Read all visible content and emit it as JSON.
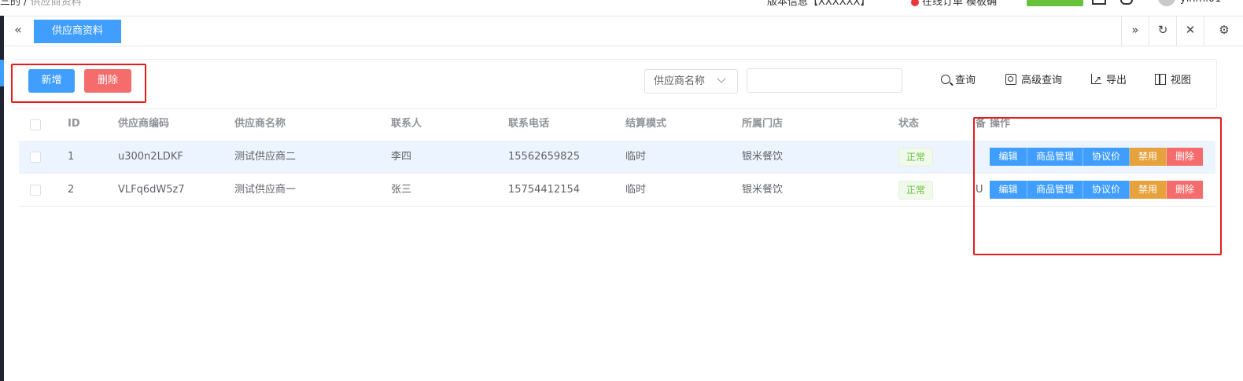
{
  "topbar": {
    "crumb": "三的 /",
    "crumb_sub": "供应商资料",
    "version": "版本信息【XXXXXX】",
    "alert": "在线订单 模板确",
    "user": "yinmi01"
  },
  "tabs": {
    "collapse_icon": "«",
    "active_tab": "供应商资料",
    "forward_icon": "»",
    "refresh_icon": "↻",
    "close_icon": "✕",
    "settings_icon": "⚙"
  },
  "toolbar": {
    "add_label": "新增",
    "delete_label": "删除",
    "search_field_select": "供应商名称",
    "search_input_value": "",
    "search_input_placeholder": "",
    "query_label": "查询",
    "advanced_query_label": "高级查询",
    "export_label": "导出",
    "view_label": "视图"
  },
  "table": {
    "headers": {
      "id": "ID",
      "code": "供应商编码",
      "name": "供应商名称",
      "contact": "联系人",
      "phone": "联系电话",
      "settlement": "结算模式",
      "store": "所属门店",
      "status": "状态",
      "hidden": "备",
      "actions": "操作"
    },
    "rows": [
      {
        "id": "1",
        "code": "u300n2LDKF",
        "name": "测试供应商二",
        "contact": "李四",
        "phone": "15562659825",
        "settlement": "临时",
        "store": "银米餐饮",
        "status": "正常",
        "hidden": ""
      },
      {
        "id": "2",
        "code": "VLFq6dW5z7",
        "name": "测试供应商一",
        "contact": "张三",
        "phone": "15754412154",
        "settlement": "临时",
        "store": "银米餐饮",
        "status": "正常",
        "hidden": "U"
      }
    ],
    "row_actions": {
      "edit": "编辑",
      "goods": "商品管理",
      "price": "协议价",
      "disable": "禁用",
      "delete": "删除"
    }
  },
  "colors": {
    "primary": "#409eff",
    "danger": "#f56c6c",
    "warning": "#e6a23c",
    "success": "#67c23a",
    "annotation_red": "#e61b1b",
    "row_highlight": "#ecf5ff"
  }
}
